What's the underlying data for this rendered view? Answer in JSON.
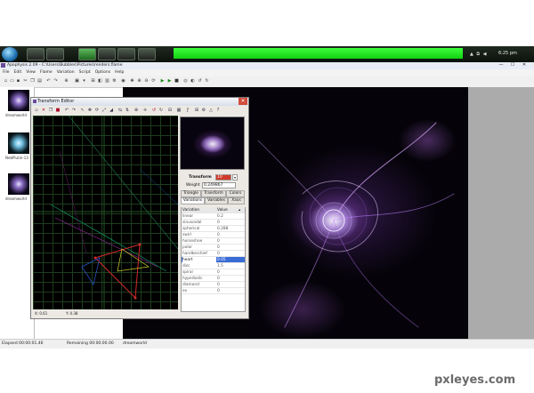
{
  "taskbar": {
    "clock": "6:25 pm",
    "tray": "▲ ⧉ ◀"
  },
  "window": {
    "title": "Apophysis 2.09 - C:\\Users\\Bubbles\\Pictures\\renders.flame",
    "controls": [
      "—",
      "☐",
      "✕"
    ]
  },
  "menu": [
    "File",
    "Edit",
    "View",
    "Flame",
    "Variation",
    "Script",
    "Options",
    "Help"
  ],
  "thumbnails": [
    {
      "label": "dreamworld"
    },
    {
      "label": "NebPlutin-13"
    },
    {
      "label": "dreamworld"
    }
  ],
  "status": {
    "elapsed": "Elapsed 00:00:01.46",
    "remaining": "Remaining 00:00:00.00",
    "name": "dreamworld"
  },
  "editor": {
    "title": "Transform Editor",
    "close": "✕",
    "coords": {
      "x": "X: 0.61",
      "y": "Y: 0.38"
    },
    "transform_label": "Transform",
    "transform_value": "10",
    "weight_label": "Weight",
    "weight_value": "0.249867",
    "tabs_row1": [
      "Triangle",
      "Transform",
      "Colors"
    ],
    "tabs_row2": [
      "Variations",
      "Variables",
      "Xaos"
    ],
    "table_header": {
      "name": "Variation",
      "value": "Value"
    },
    "variations": [
      {
        "name": "linear",
        "value": "0.2"
      },
      {
        "name": "sinusoidal",
        "value": "0"
      },
      {
        "name": "spherical",
        "value": "0.288"
      },
      {
        "name": "swirl",
        "value": "0"
      },
      {
        "name": "horseshoe",
        "value": "0"
      },
      {
        "name": "polar",
        "value": "0"
      },
      {
        "name": "handkerchief",
        "value": "0"
      },
      {
        "name": "heart",
        "value": "0.05"
      },
      {
        "name": "disc",
        "value": "1.5"
      },
      {
        "name": "spiral",
        "value": "0"
      },
      {
        "name": "hyperbolic",
        "value": "0"
      },
      {
        "name": "diamond",
        "value": "0"
      },
      {
        "name": "ex",
        "value": "0"
      }
    ]
  },
  "colors": {
    "accent_green": "#1ee01e",
    "selection": "#3a6cd6"
  },
  "watermark": "pxleyes.com"
}
